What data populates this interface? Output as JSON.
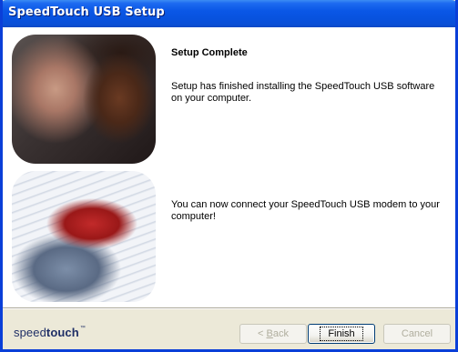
{
  "window": {
    "title": "SpeedTouch USB Setup"
  },
  "main": {
    "heading": "Setup Complete",
    "paragraph1": "Setup has finished installing the SpeedTouch USB software on your computer.",
    "paragraph2": "You can now connect your SpeedTouch USB modem to your computer!"
  },
  "images": {
    "top_photo": "photo of two people looking at a screen",
    "bottom_photo": "photo of a hand on a keyboard and mouse"
  },
  "footer": {
    "logo_light": "speed",
    "logo_bold": "touch",
    "logo_tm": "™",
    "back_hotkey": "B",
    "back_rest": "ack",
    "back_prefix": "< ",
    "finish_label": "Finish",
    "cancel_label": "Cancel"
  },
  "colors": {
    "titlebar": "#0a57e6",
    "window_body": "#ece9d8",
    "content_bg": "#ffffff",
    "disabled_text": "#b0ae9e"
  }
}
